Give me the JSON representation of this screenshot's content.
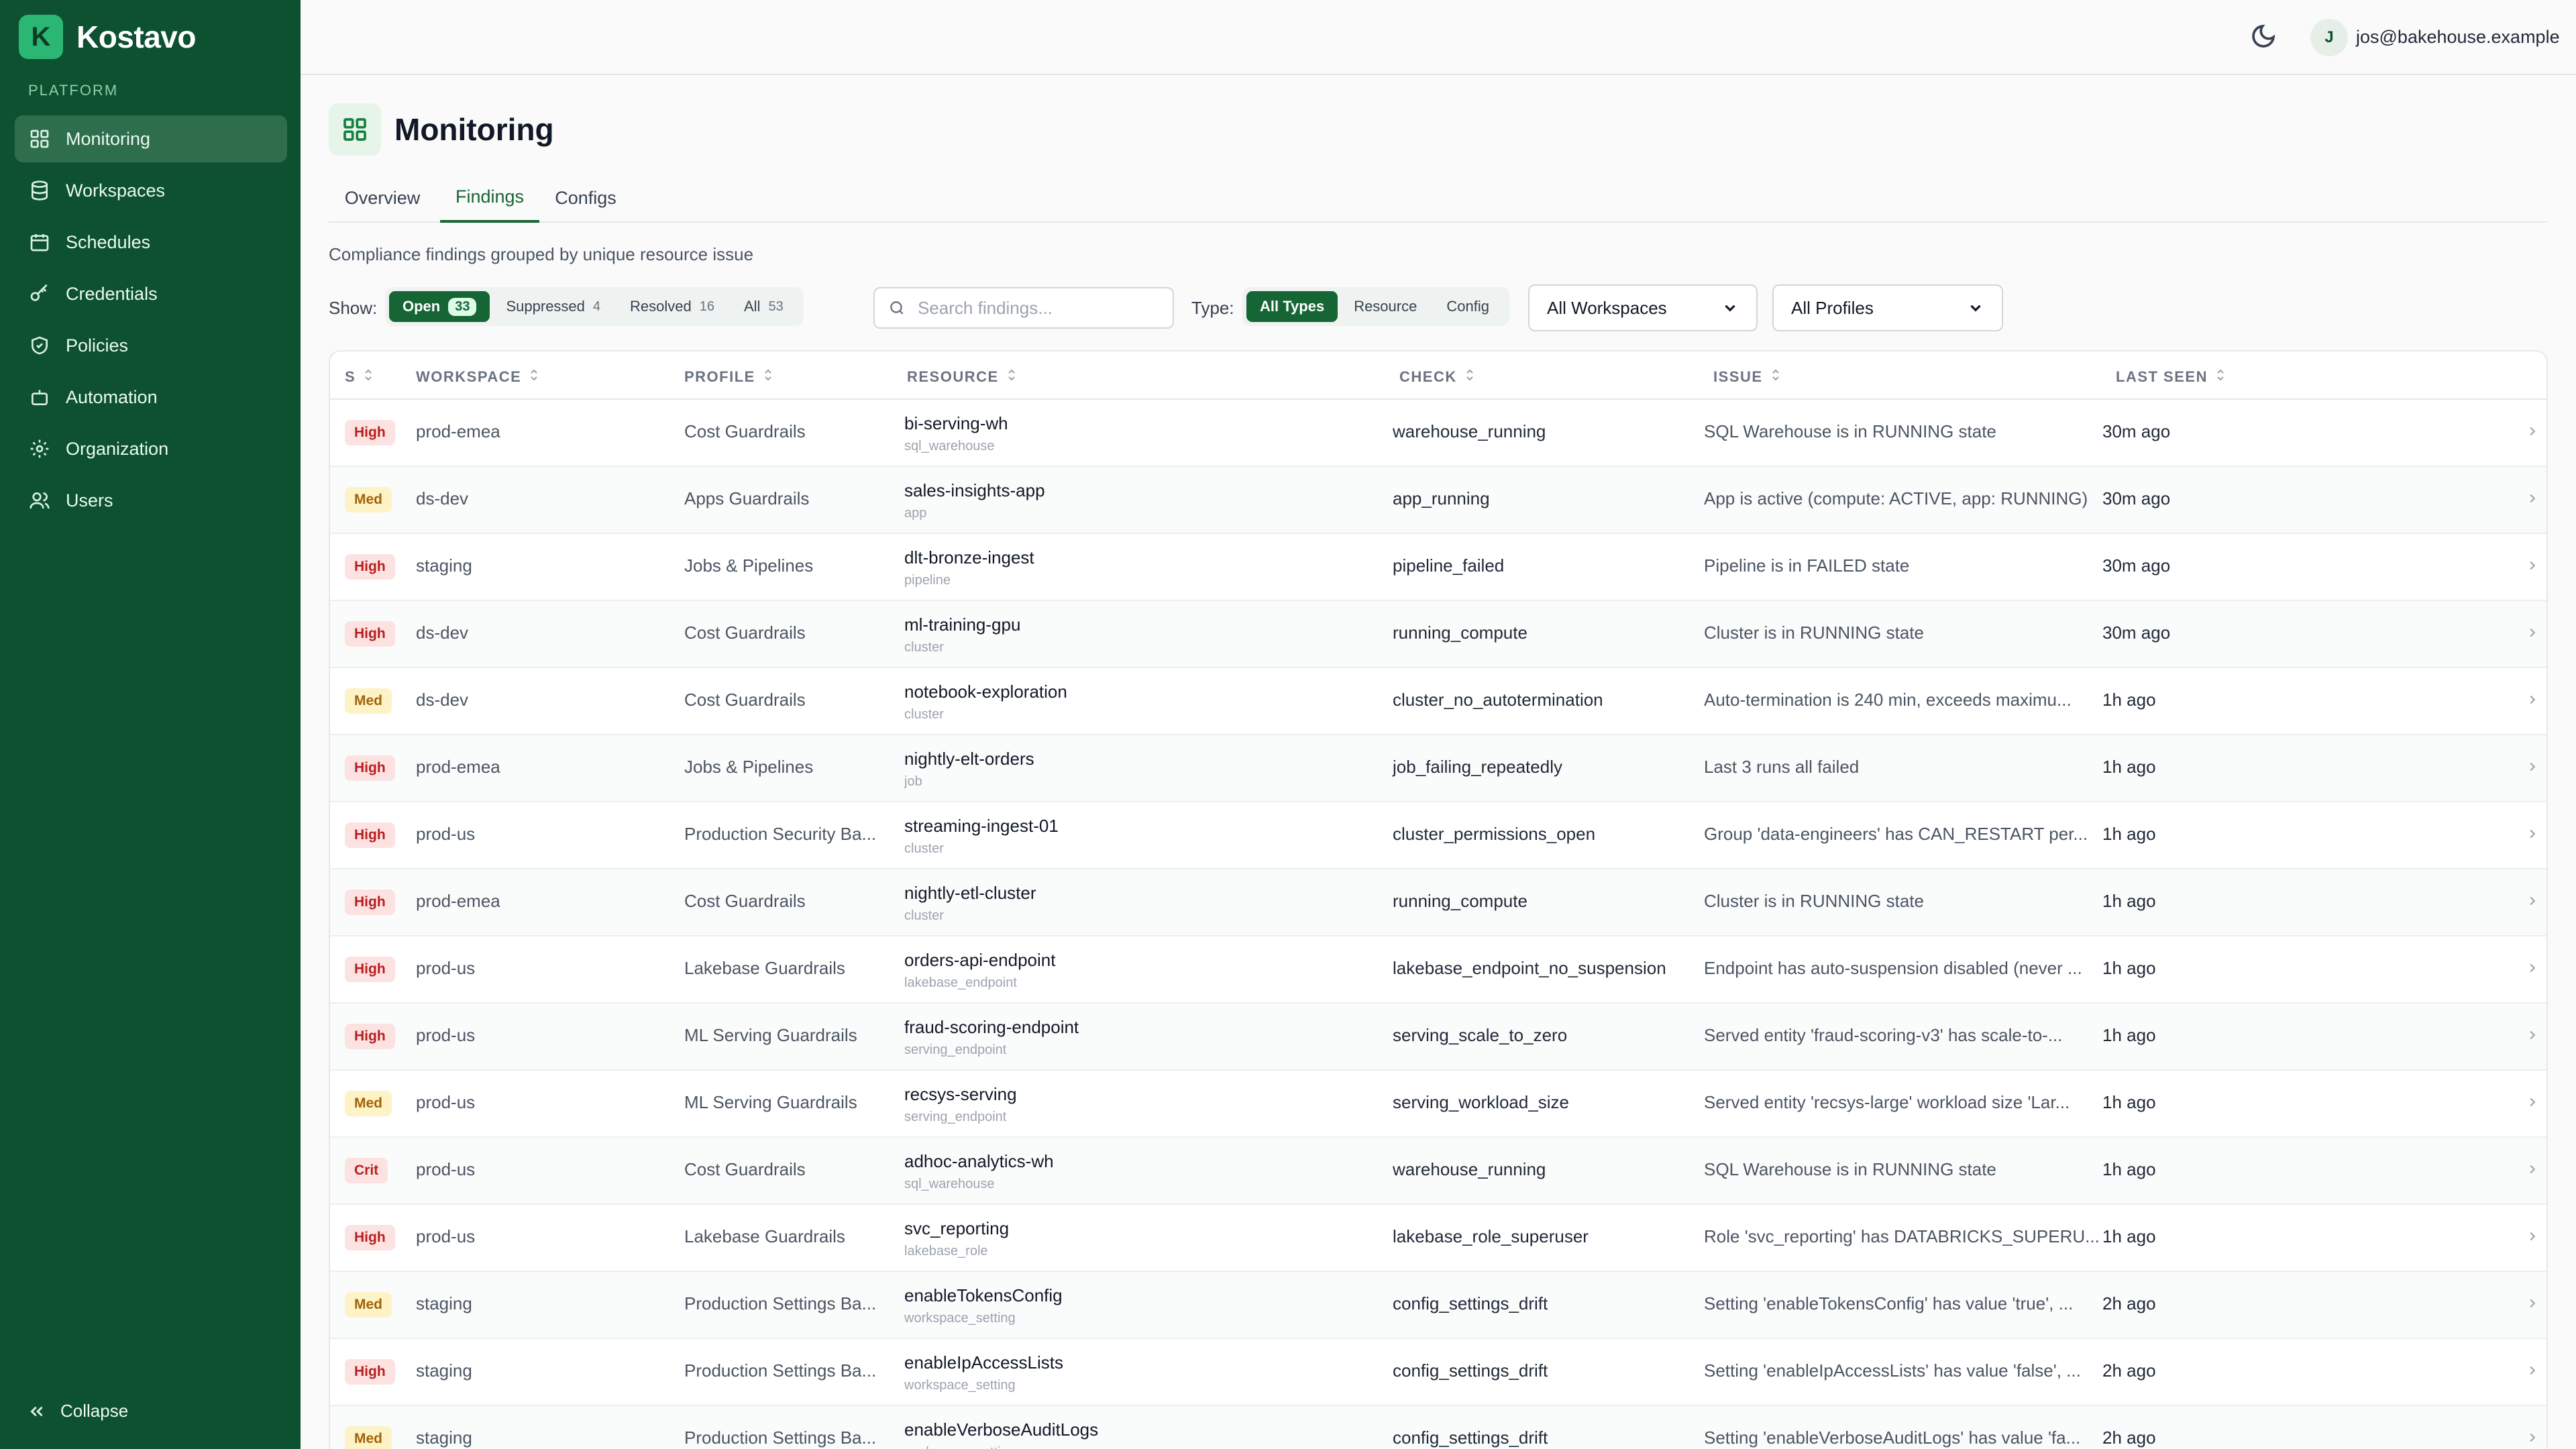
{
  "brand": {
    "logo_letter": "K",
    "name": "Kostavo"
  },
  "sidebar": {
    "section_label": "PLATFORM",
    "items": [
      {
        "label": "Monitoring",
        "icon": "grid-icon",
        "active": true
      },
      {
        "label": "Workspaces",
        "icon": "database-icon",
        "active": false
      },
      {
        "label": "Schedules",
        "icon": "calendar-icon",
        "active": false
      },
      {
        "label": "Credentials",
        "icon": "key-icon",
        "active": false
      },
      {
        "label": "Policies",
        "icon": "shield-icon",
        "active": false
      },
      {
        "label": "Automation",
        "icon": "bot-icon",
        "active": false
      },
      {
        "label": "Organization",
        "icon": "gear-icon",
        "active": false
      },
      {
        "label": "Users",
        "icon": "users-icon",
        "active": false
      }
    ],
    "collapse_label": "Collapse"
  },
  "topbar": {
    "avatar_initial": "J",
    "user_email": "jos@bakehouse.example"
  },
  "page": {
    "title": "Monitoring",
    "tabs": [
      {
        "label": "Overview",
        "active": false
      },
      {
        "label": "Findings",
        "active": true
      },
      {
        "label": "Configs",
        "active": false
      }
    ],
    "subtitle": "Compliance findings grouped by unique resource issue"
  },
  "filters": {
    "show_label": "Show:",
    "show_options": [
      {
        "label": "Open",
        "count": "33",
        "active": true
      },
      {
        "label": "Suppressed",
        "count": "4",
        "active": false
      },
      {
        "label": "Resolved",
        "count": "16",
        "active": false
      },
      {
        "label": "All",
        "count": "53",
        "active": false
      }
    ],
    "search_placeholder": "Search findings...",
    "type_label": "Type:",
    "type_options": [
      {
        "label": "All Types",
        "active": true
      },
      {
        "label": "Resource",
        "active": false
      },
      {
        "label": "Config",
        "active": false
      }
    ],
    "workspace_select": "All Workspaces",
    "profile_select": "All Profiles"
  },
  "table": {
    "headers": [
      "S",
      "WORKSPACE",
      "PROFILE",
      "RESOURCE",
      "CHECK",
      "ISSUE",
      "LAST SEEN"
    ],
    "rows": [
      {
        "severity": "High",
        "workspace": "prod-emea",
        "profile": "Cost Guardrails",
        "resource": "bi-serving-wh",
        "resource_type": "sql_warehouse",
        "check": "warehouse_running",
        "issue": "SQL Warehouse is in RUNNING state",
        "last_seen": "30m ago"
      },
      {
        "severity": "Med",
        "workspace": "ds-dev",
        "profile": "Apps Guardrails",
        "resource": "sales-insights-app",
        "resource_type": "app",
        "check": "app_running",
        "issue": "App is active (compute: ACTIVE, app: RUNNING)",
        "last_seen": "30m ago"
      },
      {
        "severity": "High",
        "workspace": "staging",
        "profile": "Jobs & Pipelines",
        "resource": "dlt-bronze-ingest",
        "resource_type": "pipeline",
        "check": "pipeline_failed",
        "issue": "Pipeline is in FAILED state",
        "last_seen": "30m ago"
      },
      {
        "severity": "High",
        "workspace": "ds-dev",
        "profile": "Cost Guardrails",
        "resource": "ml-training-gpu",
        "resource_type": "cluster",
        "check": "running_compute",
        "issue": "Cluster is in RUNNING state",
        "last_seen": "30m ago"
      },
      {
        "severity": "Med",
        "workspace": "ds-dev",
        "profile": "Cost Guardrails",
        "resource": "notebook-exploration",
        "resource_type": "cluster",
        "check": "cluster_no_autotermination",
        "issue": "Auto-termination is 240 min, exceeds maximu...",
        "last_seen": "1h ago"
      },
      {
        "severity": "High",
        "workspace": "prod-emea",
        "profile": "Jobs & Pipelines",
        "resource": "nightly-elt-orders",
        "resource_type": "job",
        "check": "job_failing_repeatedly",
        "issue": "Last 3 runs all failed",
        "last_seen": "1h ago"
      },
      {
        "severity": "High",
        "workspace": "prod-us",
        "profile": "Production Security Ba...",
        "resource": "streaming-ingest-01",
        "resource_type": "cluster",
        "check": "cluster_permissions_open",
        "issue": "Group 'data-engineers' has CAN_RESTART per...",
        "last_seen": "1h ago"
      },
      {
        "severity": "High",
        "workspace": "prod-emea",
        "profile": "Cost Guardrails",
        "resource": "nightly-etl-cluster",
        "resource_type": "cluster",
        "check": "running_compute",
        "issue": "Cluster is in RUNNING state",
        "last_seen": "1h ago"
      },
      {
        "severity": "High",
        "workspace": "prod-us",
        "profile": "Lakebase Guardrails",
        "resource": "orders-api-endpoint",
        "resource_type": "lakebase_endpoint",
        "check": "lakebase_endpoint_no_suspension",
        "issue": "Endpoint has auto-suspension disabled (never ...",
        "last_seen": "1h ago"
      },
      {
        "severity": "High",
        "workspace": "prod-us",
        "profile": "ML Serving Guardrails",
        "resource": "fraud-scoring-endpoint",
        "resource_type": "serving_endpoint",
        "check": "serving_scale_to_zero",
        "issue": "Served entity 'fraud-scoring-v3' has scale-to-...",
        "last_seen": "1h ago"
      },
      {
        "severity": "Med",
        "workspace": "prod-us",
        "profile": "ML Serving Guardrails",
        "resource": "recsys-serving",
        "resource_type": "serving_endpoint",
        "check": "serving_workload_size",
        "issue": "Served entity 'recsys-large' workload size 'Lar...",
        "last_seen": "1h ago"
      },
      {
        "severity": "Crit",
        "workspace": "prod-us",
        "profile": "Cost Guardrails",
        "resource": "adhoc-analytics-wh",
        "resource_type": "sql_warehouse",
        "check": "warehouse_running",
        "issue": "SQL Warehouse is in RUNNING state",
        "last_seen": "1h ago"
      },
      {
        "severity": "High",
        "workspace": "prod-us",
        "profile": "Lakebase Guardrails",
        "resource": "svc_reporting",
        "resource_type": "lakebase_role",
        "check": "lakebase_role_superuser",
        "issue": "Role 'svc_reporting' has DATABRICKS_SUPERU...",
        "last_seen": "1h ago"
      },
      {
        "severity": "Med",
        "workspace": "staging",
        "profile": "Production Settings Ba...",
        "resource": "enableTokensConfig",
        "resource_type": "workspace_setting",
        "check": "config_settings_drift",
        "issue": "Setting 'enableTokensConfig' has value 'true', ...",
        "last_seen": "2h ago"
      },
      {
        "severity": "High",
        "workspace": "staging",
        "profile": "Production Settings Ba...",
        "resource": "enableIpAccessLists",
        "resource_type": "workspace_setting",
        "check": "config_settings_drift",
        "issue": "Setting 'enableIpAccessLists' has value 'false', ...",
        "last_seen": "2h ago"
      },
      {
        "severity": "Med",
        "workspace": "staging",
        "profile": "Production Settings Ba...",
        "resource": "enableVerboseAuditLogs",
        "resource_type": "workspace_setting",
        "check": "config_settings_drift",
        "issue": "Setting 'enableVerboseAuditLogs' has value 'fa...",
        "last_seen": "2h ago"
      }
    ]
  }
}
